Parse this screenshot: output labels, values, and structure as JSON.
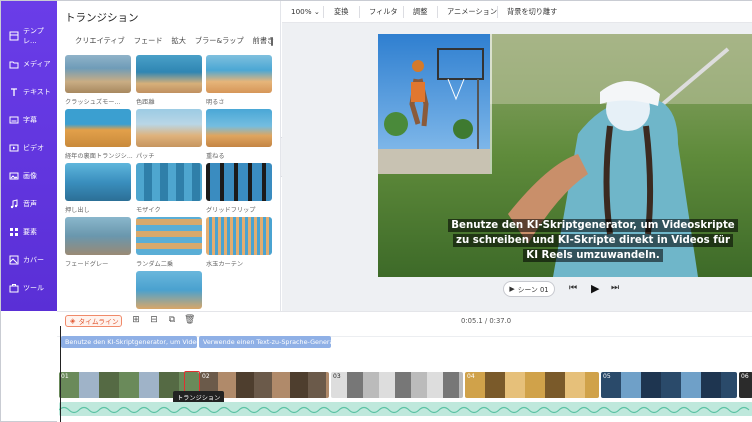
{
  "sidebar": {
    "items": [
      {
        "label": "テンプレ...",
        "icon": "template-icon"
      },
      {
        "label": "メディア",
        "icon": "folder-icon"
      },
      {
        "label": "テキスト",
        "icon": "text-icon"
      },
      {
        "label": "字幕",
        "icon": "subtitle-icon"
      },
      {
        "label": "ビデオ",
        "icon": "video-icon"
      },
      {
        "label": "画像",
        "icon": "image-icon"
      },
      {
        "label": "音声",
        "icon": "music-icon"
      },
      {
        "label": "要素",
        "icon": "elements-icon"
      },
      {
        "label": "カバー",
        "icon": "cover-icon"
      },
      {
        "label": "ツール",
        "icon": "toolbox-icon"
      }
    ]
  },
  "panel": {
    "title": "トランジション",
    "categories": [
      "クリエイティブ",
      "フェード",
      "拡大",
      "ブラー&ラップ",
      "前書き"
    ],
    "transitions": [
      "クラッシュズモー...",
      "色距離",
      "明るさ",
      "経年の裏面トランジシ...",
      "パッチ",
      "重ねる",
      "押し出し",
      "モザイク",
      "グリッドフリップ",
      "フェードグレー",
      "ランダム二乗",
      "水玉カーテン",
      ""
    ]
  },
  "topbar": {
    "zoom": "100%",
    "items": [
      "変換",
      "フィルタ",
      "調整",
      "アニメーション",
      "背景を切り離す"
    ]
  },
  "preview": {
    "caption": "Benutze den KI-Skriptgenerator, um Videoskripte zu schreiben und KI-Skripte direkt in Videos für KI Reels umzuwandeln.",
    "scene_label": "シーン 01"
  },
  "timeline": {
    "button_label": "タイムライン",
    "time": "0:05.1 / 0:37.0",
    "text_clips": [
      "Benutze den KI-Skriptgenerator, um Videosk...",
      "Verwende einen Text-zu-Sprache-Generator, ..."
    ],
    "clip_numbers": [
      "01",
      "02",
      "03",
      "04",
      "05",
      "06"
    ],
    "tooltip": "トランジション"
  },
  "colors": {
    "sidebar": "#5a2fd6",
    "accent": "#e0552f",
    "text_clip": "#8fb0e6",
    "audio": "#bfe8dc"
  }
}
